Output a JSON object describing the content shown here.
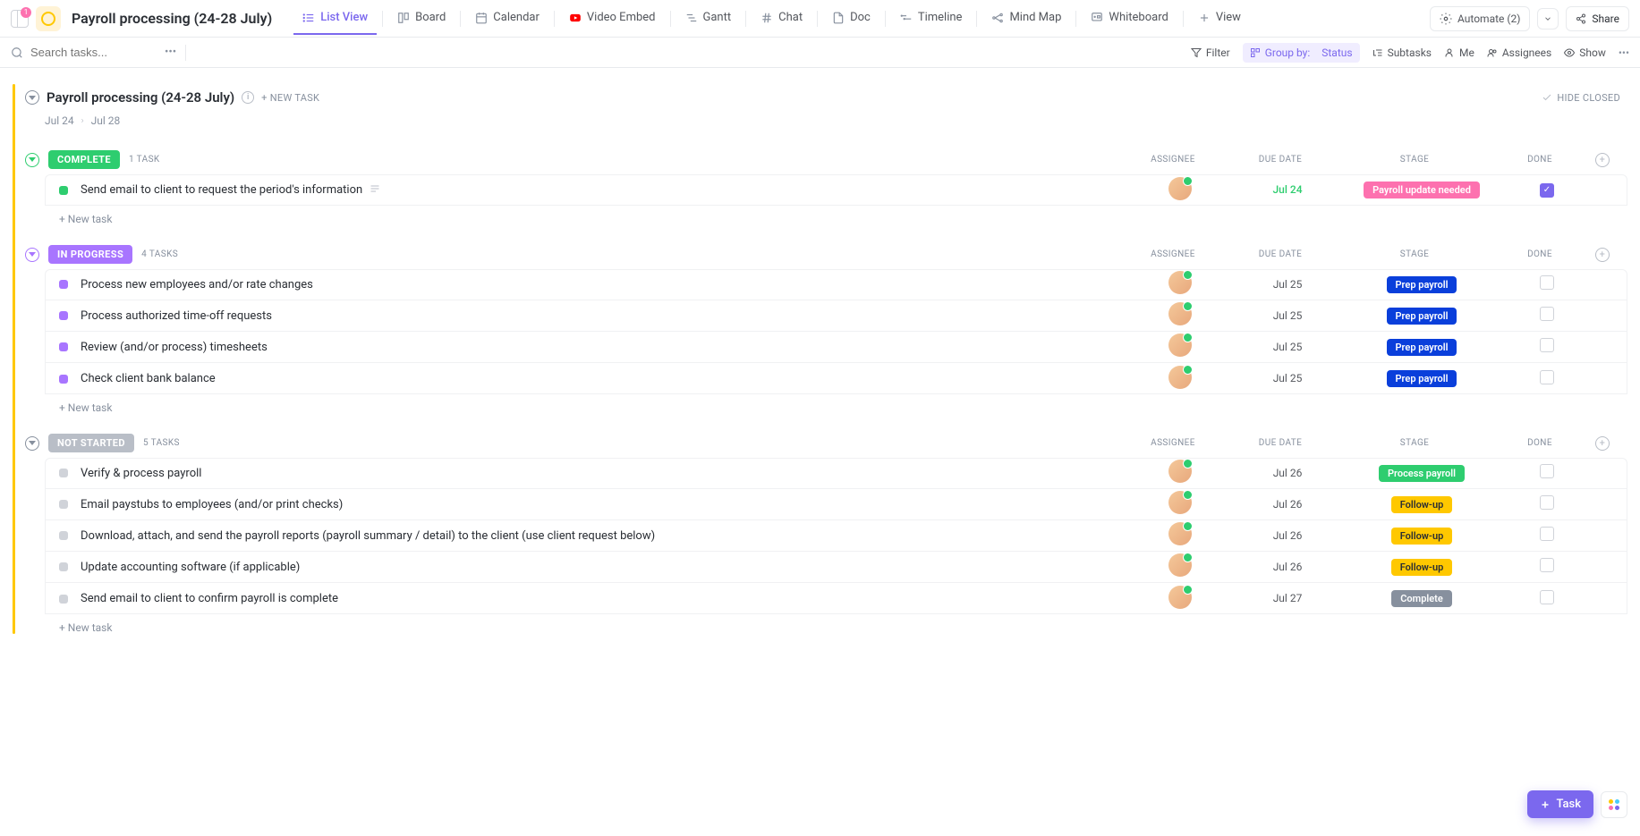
{
  "header": {
    "notification_count": "1",
    "page_title": "Payroll processing (24-28 July)",
    "views": [
      {
        "label": "List View",
        "active": true,
        "icon": "list"
      },
      {
        "label": "Board",
        "icon": "board"
      },
      {
        "label": "Calendar",
        "icon": "calendar"
      },
      {
        "label": "Video Embed",
        "icon": "youtube"
      },
      {
        "label": "Gantt",
        "icon": "gantt"
      },
      {
        "label": "Chat",
        "icon": "hash"
      },
      {
        "label": "Doc",
        "icon": "doc"
      },
      {
        "label": "Timeline",
        "icon": "timeline"
      },
      {
        "label": "Mind Map",
        "icon": "mindmap"
      },
      {
        "label": "Whiteboard",
        "icon": "whiteboard"
      }
    ],
    "add_view_label": "View",
    "automate_label": "Automate (2)",
    "share_label": "Share"
  },
  "toolbar": {
    "search_placeholder": "Search tasks...",
    "filter": "Filter",
    "group_by_label": "Group by:",
    "group_by_value": "Status",
    "subtasks": "Subtasks",
    "me": "Me",
    "assignees": "Assignees",
    "show": "Show"
  },
  "list": {
    "title": "Payroll processing (24-28 July)",
    "new_task_label": "+ NEW TASK",
    "hide_closed_label": "HIDE CLOSED",
    "start_date": "Jul 24",
    "end_date": "Jul 28",
    "columns": {
      "assignee": "ASSIGNEE",
      "due_date": "DUE DATE",
      "stage": "STAGE",
      "done": "DONE"
    }
  },
  "groups": [
    {
      "status": "COMPLETE",
      "status_class": "complete",
      "count": "1 TASK",
      "tasks": [
        {
          "name": "Send email to client to request the period's information",
          "has_desc": true,
          "due": "Jul 24",
          "due_green": true,
          "stage": "Payroll update needed",
          "stage_class": "stage-pink",
          "done": true
        }
      ]
    },
    {
      "status": "IN PROGRESS",
      "status_class": "inprogress",
      "count": "4 TASKS",
      "tasks": [
        {
          "name": "Process new employees and/or rate changes",
          "due": "Jul 25",
          "stage": "Prep payroll",
          "stage_class": "stage-blue",
          "done": false
        },
        {
          "name": "Process authorized time-off requests",
          "due": "Jul 25",
          "stage": "Prep payroll",
          "stage_class": "stage-blue",
          "done": false
        },
        {
          "name": "Review (and/or process) timesheets",
          "due": "Jul 25",
          "stage": "Prep payroll",
          "stage_class": "stage-blue",
          "done": false
        },
        {
          "name": "Check client bank balance",
          "due": "Jul 25",
          "stage": "Prep payroll",
          "stage_class": "stage-blue",
          "done": false
        }
      ]
    },
    {
      "status": "NOT STARTED",
      "status_class": "notstarted",
      "count": "5 TASKS",
      "tasks": [
        {
          "name": "Verify & process payroll",
          "due": "Jul 26",
          "stage": "Process payroll",
          "stage_class": "stage-green",
          "done": false
        },
        {
          "name": "Email paystubs to employees (and/or print checks)",
          "due": "Jul 26",
          "stage": "Follow-up",
          "stage_class": "stage-yellow",
          "done": false
        },
        {
          "name": "Download, attach, and send the payroll reports (payroll summary / detail) to the client (use client request below)",
          "due": "Jul 26",
          "stage": "Follow-up",
          "stage_class": "stage-yellow",
          "done": false
        },
        {
          "name": "Update accounting software (if applicable)",
          "due": "Jul 26",
          "stage": "Follow-up",
          "stage_class": "stage-yellow",
          "done": false
        },
        {
          "name": "Send email to client to confirm payroll is complete",
          "due": "Jul 27",
          "stage": "Complete",
          "stage_class": "stage-grey",
          "done": false
        }
      ]
    }
  ],
  "add_task_row": "+ New task",
  "float_task_label": "Task"
}
